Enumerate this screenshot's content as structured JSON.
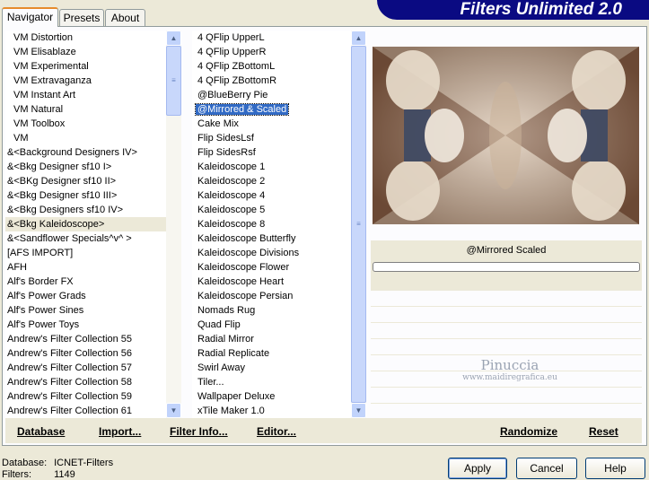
{
  "tabs": [
    "Navigator",
    "Presets",
    "About"
  ],
  "title": "Filters Unlimited 2.0",
  "categories": [
    {
      "label": "VM Distortion",
      "indent": true
    },
    {
      "label": "VM Elisablaze",
      "indent": true
    },
    {
      "label": "VM Experimental",
      "indent": true
    },
    {
      "label": "VM Extravaganza",
      "indent": true
    },
    {
      "label": "VM Instant Art",
      "indent": true
    },
    {
      "label": "VM Natural",
      "indent": true
    },
    {
      "label": "VM Toolbox",
      "indent": true
    },
    {
      "label": "VM",
      "indent": true
    },
    {
      "label": "&<Background Designers IV>",
      "indent": false
    },
    {
      "label": "&<Bkg Designer sf10 I>",
      "indent": false
    },
    {
      "label": "&<BKg Designer sf10 II>",
      "indent": false
    },
    {
      "label": "&<Bkg Designer sf10 III>",
      "indent": false
    },
    {
      "label": "&<Bkg Designers sf10 IV>",
      "indent": false
    },
    {
      "label": "&<Bkg Kaleidoscope>",
      "indent": false,
      "selected": true
    },
    {
      "label": "&<Sandflower Specials^v^ >",
      "indent": false
    },
    {
      "label": "[AFS IMPORT]",
      "indent": false
    },
    {
      "label": "AFH",
      "indent": false
    },
    {
      "label": "Alf's Border FX",
      "indent": false
    },
    {
      "label": "Alf's Power Grads",
      "indent": false
    },
    {
      "label": "Alf's Power Sines",
      "indent": false
    },
    {
      "label": "Alf's Power Toys",
      "indent": false
    },
    {
      "label": "Andrew's Filter Collection 55",
      "indent": false
    },
    {
      "label": "Andrew's Filter Collection 56",
      "indent": false
    },
    {
      "label": "Andrew's Filter Collection 57",
      "indent": false
    },
    {
      "label": "Andrew's Filter Collection 58",
      "indent": false
    },
    {
      "label": "Andrew's Filter Collection 59",
      "indent": false
    },
    {
      "label": "Andrew's Filter Collection 61",
      "indent": false
    }
  ],
  "filters": [
    {
      "label": "4 QFlip UpperL"
    },
    {
      "label": "4 QFlip UpperR"
    },
    {
      "label": "4 QFlip ZBottomL"
    },
    {
      "label": "4 QFlip ZBottomR"
    },
    {
      "label": "@BlueBerry Pie"
    },
    {
      "label": "@Mirrored & Scaled",
      "selected": true
    },
    {
      "label": "Cake Mix"
    },
    {
      "label": "Flip SidesLsf"
    },
    {
      "label": "Flip SidesRsf"
    },
    {
      "label": "Kaleidoscope 1"
    },
    {
      "label": "Kaleidoscope 2"
    },
    {
      "label": "Kaleidoscope 4"
    },
    {
      "label": "Kaleidoscope 5"
    },
    {
      "label": "Kaleidoscope 8"
    },
    {
      "label": "Kaleidoscope Butterfly"
    },
    {
      "label": "Kaleidoscope Divisions"
    },
    {
      "label": "Kaleidoscope Flower"
    },
    {
      "label": "Kaleidoscope Heart"
    },
    {
      "label": "Kaleidoscope Persian"
    },
    {
      "label": "Nomads Rug"
    },
    {
      "label": "Quad Flip"
    },
    {
      "label": "Radial Mirror"
    },
    {
      "label": "Radial Replicate"
    },
    {
      "label": "Swirl Away"
    },
    {
      "label": "Tiler..."
    },
    {
      "label": "Wallpaper Deluxe"
    },
    {
      "label": "xTile Maker 1.0"
    }
  ],
  "preview": {
    "filter_name": "@Mirrored  Scaled"
  },
  "watermark": {
    "line1": "Pinuccia",
    "line2": "www.maidiregrafica.eu"
  },
  "bottom_buttons": {
    "database": "Database",
    "import": "Import...",
    "filter_info": "Filter Info...",
    "editor": "Editor...",
    "randomize": "Randomize",
    "reset": "Reset"
  },
  "status": {
    "database_label": "Database:",
    "database_value": "ICNET-Filters",
    "filters_label": "Filters:",
    "filters_value": "1149"
  },
  "dialog_buttons": {
    "apply": "Apply",
    "cancel": "Cancel",
    "help": "Help"
  },
  "colors": {
    "accent": "#316ac5",
    "banner": "#0a0a82",
    "tab_highlight": "#e68b2c"
  },
  "icons": {
    "scroll_up": "up-arrow-icon",
    "scroll_down": "down-arrow-icon",
    "grip": "scroll-grip-icon"
  }
}
